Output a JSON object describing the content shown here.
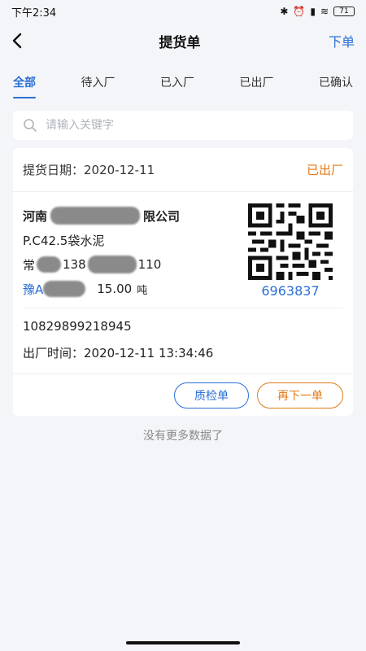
{
  "status_bar": {
    "time": "下午2:34",
    "battery": "71"
  },
  "nav": {
    "title": "提货单",
    "action": "下单"
  },
  "tabs": [
    {
      "label": "全部",
      "active": true
    },
    {
      "label": "待入厂",
      "active": false
    },
    {
      "label": "已入厂",
      "active": false
    },
    {
      "label": "已出厂",
      "active": false
    },
    {
      "label": "已确认",
      "active": false
    }
  ],
  "search": {
    "placeholder": "请输入关键字"
  },
  "order": {
    "date_label": "提货日期：2020-12-11",
    "status": "已出厂",
    "company_prefix": "河南",
    "company_suffix": "限公司",
    "product": "P.C42.5袋水泥",
    "contact_prefix": "常",
    "phone_part1": "138",
    "phone_part2": "110",
    "plate_prefix": "豫A",
    "weight": "15.00",
    "unit": "吨",
    "qr_number": "6963837",
    "order_no": "10829899218945",
    "exit_time": "出厂时间：2020-12-11 13:34:46",
    "btn_quality": "质检单",
    "btn_reorder": "再下一单"
  },
  "footer": {
    "no_more": "没有更多数据了"
  }
}
